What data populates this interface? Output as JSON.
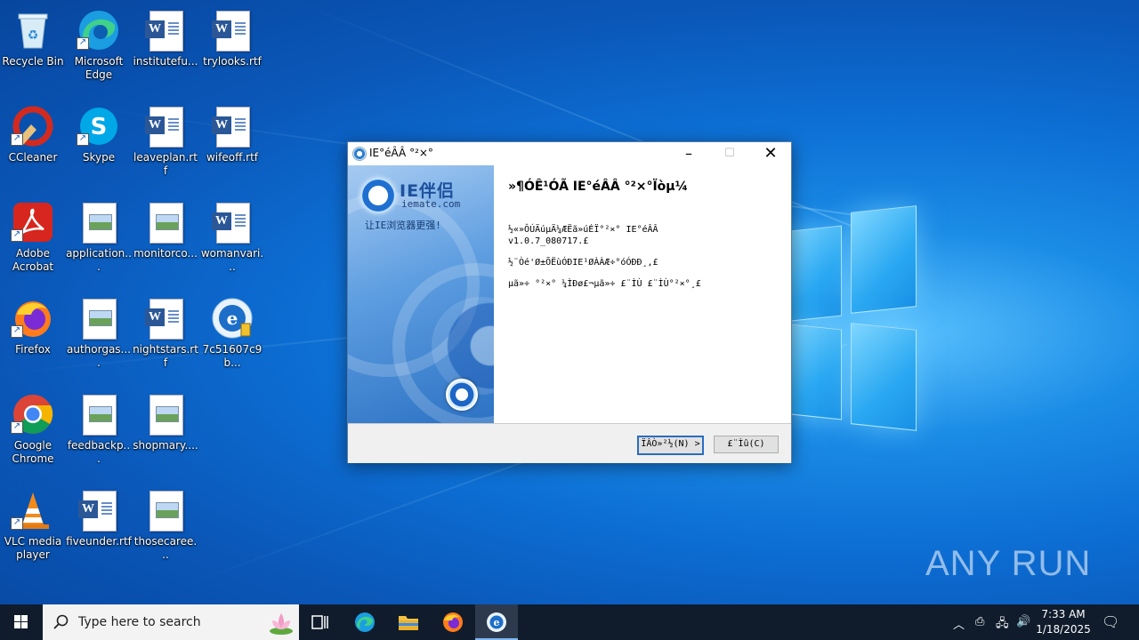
{
  "desktop": {
    "icons": [
      {
        "label": "Recycle Bin"
      },
      {
        "label": "Microsoft Edge"
      },
      {
        "label": "institutefu..."
      },
      {
        "label": "trylooks.rtf"
      },
      {
        "label": "CCleaner"
      },
      {
        "label": "Skype"
      },
      {
        "label": "leaveplan.rtf"
      },
      {
        "label": "wifeoff.rtf"
      },
      {
        "label": "Adobe Acrobat"
      },
      {
        "label": "application..."
      },
      {
        "label": "monitorco..."
      },
      {
        "label": "womanvari..."
      },
      {
        "label": "Firefox"
      },
      {
        "label": "authorgas...."
      },
      {
        "label": "nightstars.rtf"
      },
      {
        "label": "7c51607c9b..."
      },
      {
        "label": "Google Chrome"
      },
      {
        "label": "feedbackp..."
      },
      {
        "label": "shopmary...."
      },
      {
        "label": "VLC media player"
      },
      {
        "label": "fiveunder.rtf"
      },
      {
        "label": "thosecaree..."
      }
    ],
    "watermark": "ANY RUN"
  },
  "dialog": {
    "title": "IE°éÂÂ °²×°",
    "logo_text": "IE伴侣",
    "logo_url": "iemate.com",
    "slogan": "让IE浏览器更强!",
    "heading": "»¶Ó­Ê¹ÓÃ IE°éÂÂ °²×°Ïòµ¼",
    "line1": "½«»ÔÚÄúµÄ¼ÆËã»úÉÏ°²×° IE°éÂÂ",
    "line1b": "v1.0.7_080717.£",
    "line2": "½¨Òé'Ø±ÕËùÓÐIE¹ØÀÀÆ÷°óÓÐÐ¸,£",
    "line3": "µã»÷ °²×° ¼ÌÐø£¬µã»÷ £¨ÌÙ £¨ÌÙ°²×°¸£",
    "next_label": "ÏÂÒ»²½(N) >",
    "cancel_label": "£¨Ìû(C)"
  },
  "taskbar": {
    "search_placeholder": "Type here to search",
    "time": "7:33 AM",
    "date": "1/18/2025"
  }
}
